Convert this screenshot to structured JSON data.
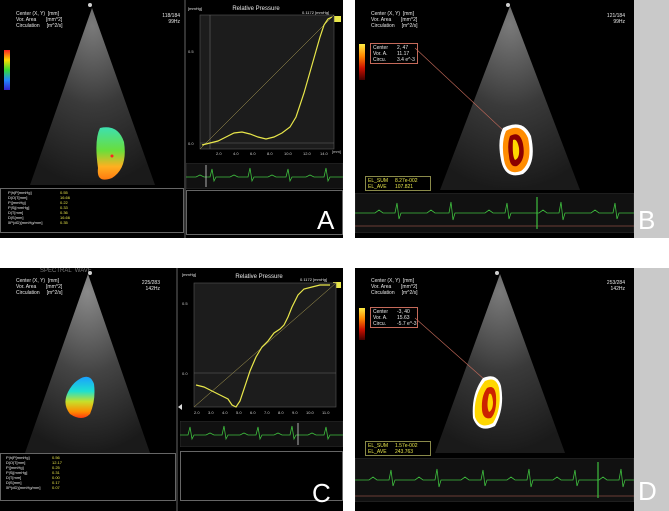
{
  "panels": {
    "A": {
      "letter": "A",
      "legend": [
        "Center (X, Y)  [mm]",
        "Vor. Area       [mm^2]",
        "Circulation     [m^2/s]"
      ],
      "frame": "118/184",
      "rate": "99Hz",
      "params_labels": [
        "P|h|P[mmHg]",
        "D|O|T[mm]",
        "P|[mmHg]",
        "P|S|[mmHg]",
        "D|T[mm]",
        "D|S[mm]",
        "δP(dD)[mmHg/mm]"
      ],
      "params_values": [
        "0.55",
        "16.66",
        "0.22",
        "0.33",
        "0.36",
        "16.66",
        "0.35"
      ],
      "chart": {
        "title": "Relative Pressure",
        "unit": "[mmHg]",
        "corner": "0.1172 [mmHg]",
        "xlabel": "[mm]",
        "xticks": [
          "2.0",
          "4.0",
          "6.0",
          "8.0",
          "10.0",
          "12.0",
          "14.0"
        ],
        "yticks": [
          "0.5",
          "0.0"
        ]
      }
    },
    "B": {
      "letter": "B",
      "legend": [
        "Center (X, Y)  [mm]",
        "Vor. Area       [mm^2]",
        "Circulation     [m^2/s]"
      ],
      "frame": "121/184",
      "rate": "99Hz",
      "info": [
        [
          "Center",
          "2, 47"
        ],
        [
          "Vor. A.",
          "11.17"
        ],
        [
          "Circu.",
          "3.4 e^-3"
        ]
      ],
      "el": [
        [
          "EL_SUM",
          "8.27e-002"
        ],
        [
          "EL_AVE",
          "107.821"
        ]
      ]
    },
    "C": {
      "letter": "C",
      "header_partial": "SPECTRAL  WAVE",
      "legend": [
        "Center (X, Y)  [mm]",
        "Vor. Area       [mm^2]",
        "Circulation     [m^2/s]"
      ],
      "frame": "225/283",
      "rate": "142Hz",
      "params_labels": [
        "P|h|P[mmHg]",
        "D|O|T[mm]",
        "P|[mmHg]",
        "P|S|[mmHg]",
        "D|T[mm]",
        "D|S[mm]",
        "δP(dD)[mmHg/mm]"
      ],
      "params_values": [
        "0.56",
        "12.17",
        "0.25",
        "0.31",
        "0.00",
        "0.17",
        "0.07"
      ],
      "chart": {
        "title": "Relative Pressure",
        "unit": "[mmHg]",
        "corner": "0.1172 [mmHg]",
        "xlabel": "[mm]",
        "xticks": [
          "2.0",
          "3.0",
          "4.0",
          "5.0",
          "6.0",
          "7.0",
          "8.0",
          "9.0",
          "10.0",
          "11.0"
        ],
        "yticks": [
          "0.5",
          "0.0"
        ]
      }
    },
    "D": {
      "letter": "D",
      "legend": [
        "Center (X, Y)  [mm]",
        "Vor. Area       [mm^2]",
        "Circulation     [m^2/s]"
      ],
      "frame": "253/284",
      "rate": "142Hz",
      "info": [
        [
          "Center",
          "-3, 40"
        ],
        [
          "Vor. A.",
          "15.63"
        ],
        [
          "Circu.",
          "-5.7 e^-3"
        ]
      ],
      "el": [
        [
          "EL_SUM",
          "1.57e-002"
        ],
        [
          "EL_AVE",
          "243.763"
        ]
      ]
    }
  },
  "colors": {
    "curve": "#e8e64a",
    "ecg": "#3fbf3f",
    "background": "#000000",
    "gray": "#c9c9c9"
  }
}
